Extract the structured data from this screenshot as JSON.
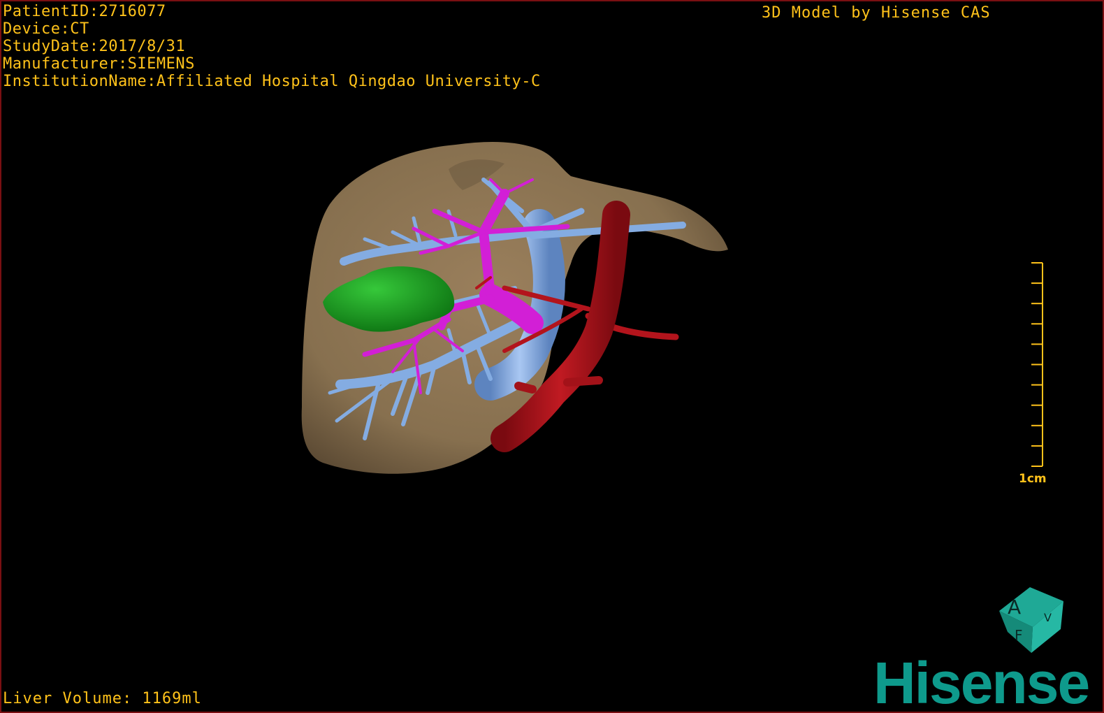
{
  "overlay": {
    "patient_id": "PatientID:2716077",
    "device": "Device:CT",
    "study_date": "StudyDate:2017/8/31",
    "manufacturer": "Manufacturer:SIEMENS",
    "institution": "InstitutionName:Affiliated Hospital Qingdao University-C",
    "model_credit": "3D Model by Hisense CAS",
    "liver_volume": "Liver Volume: 1169ml"
  },
  "scale_bar": {
    "label": "1cm",
    "ticks": 10
  },
  "orientation_cube": {
    "front_label": "A",
    "side_label": "F",
    "right_label": "V"
  },
  "brand": {
    "logo_text": "Hisense"
  },
  "colors": {
    "overlay_text": "#ffc21a",
    "liver": "#8b7354",
    "portal_vein": "#d21fd6",
    "hepatic_vein": "#7fa8e0",
    "artery": "#b3141c",
    "tumor": "#18a21e",
    "brand": "#0e9a8c",
    "frame": "#7a0f12"
  },
  "icons": {
    "orientation_cube": "orientation-cube-icon",
    "scale_bar": "scale-bar-icon"
  }
}
